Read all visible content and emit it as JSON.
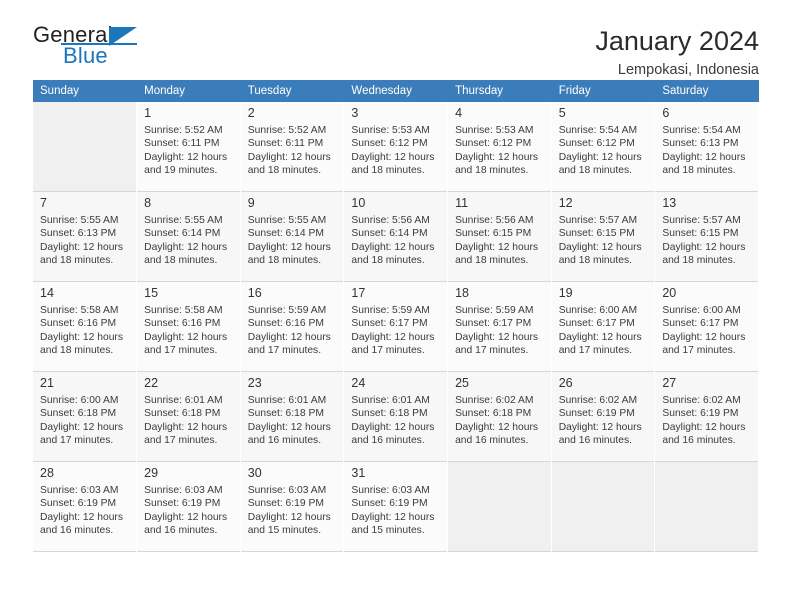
{
  "brand": {
    "name_top": "General",
    "name_bottom": "Blue",
    "accent_color": "#1b76bc",
    "triangle_icon": "triangle-icon"
  },
  "header": {
    "title": "January 2024",
    "subtitle": "Lempokasi, Indonesia"
  },
  "calendar": {
    "header_bg": "#3b7cba",
    "weekday_headers": [
      "Sunday",
      "Monday",
      "Tuesday",
      "Wednesday",
      "Thursday",
      "Friday",
      "Saturday"
    ],
    "weeks": [
      [
        {
          "day": "",
          "detail": ""
        },
        {
          "day": "1",
          "detail": "Sunrise: 5:52 AM\nSunset: 6:11 PM\nDaylight: 12 hours\nand 19 minutes."
        },
        {
          "day": "2",
          "detail": "Sunrise: 5:52 AM\nSunset: 6:11 PM\nDaylight: 12 hours\nand 18 minutes."
        },
        {
          "day": "3",
          "detail": "Sunrise: 5:53 AM\nSunset: 6:12 PM\nDaylight: 12 hours\nand 18 minutes."
        },
        {
          "day": "4",
          "detail": "Sunrise: 5:53 AM\nSunset: 6:12 PM\nDaylight: 12 hours\nand 18 minutes."
        },
        {
          "day": "5",
          "detail": "Sunrise: 5:54 AM\nSunset: 6:12 PM\nDaylight: 12 hours\nand 18 minutes."
        },
        {
          "day": "6",
          "detail": "Sunrise: 5:54 AM\nSunset: 6:13 PM\nDaylight: 12 hours\nand 18 minutes."
        }
      ],
      [
        {
          "day": "7",
          "detail": "Sunrise: 5:55 AM\nSunset: 6:13 PM\nDaylight: 12 hours\nand 18 minutes."
        },
        {
          "day": "8",
          "detail": "Sunrise: 5:55 AM\nSunset: 6:14 PM\nDaylight: 12 hours\nand 18 minutes."
        },
        {
          "day": "9",
          "detail": "Sunrise: 5:55 AM\nSunset: 6:14 PM\nDaylight: 12 hours\nand 18 minutes."
        },
        {
          "day": "10",
          "detail": "Sunrise: 5:56 AM\nSunset: 6:14 PM\nDaylight: 12 hours\nand 18 minutes."
        },
        {
          "day": "11",
          "detail": "Sunrise: 5:56 AM\nSunset: 6:15 PM\nDaylight: 12 hours\nand 18 minutes."
        },
        {
          "day": "12",
          "detail": "Sunrise: 5:57 AM\nSunset: 6:15 PM\nDaylight: 12 hours\nand 18 minutes."
        },
        {
          "day": "13",
          "detail": "Sunrise: 5:57 AM\nSunset: 6:15 PM\nDaylight: 12 hours\nand 18 minutes."
        }
      ],
      [
        {
          "day": "14",
          "detail": "Sunrise: 5:58 AM\nSunset: 6:16 PM\nDaylight: 12 hours\nand 18 minutes."
        },
        {
          "day": "15",
          "detail": "Sunrise: 5:58 AM\nSunset: 6:16 PM\nDaylight: 12 hours\nand 17 minutes."
        },
        {
          "day": "16",
          "detail": "Sunrise: 5:59 AM\nSunset: 6:16 PM\nDaylight: 12 hours\nand 17 minutes."
        },
        {
          "day": "17",
          "detail": "Sunrise: 5:59 AM\nSunset: 6:17 PM\nDaylight: 12 hours\nand 17 minutes."
        },
        {
          "day": "18",
          "detail": "Sunrise: 5:59 AM\nSunset: 6:17 PM\nDaylight: 12 hours\nand 17 minutes."
        },
        {
          "day": "19",
          "detail": "Sunrise: 6:00 AM\nSunset: 6:17 PM\nDaylight: 12 hours\nand 17 minutes."
        },
        {
          "day": "20",
          "detail": "Sunrise: 6:00 AM\nSunset: 6:17 PM\nDaylight: 12 hours\nand 17 minutes."
        }
      ],
      [
        {
          "day": "21",
          "detail": "Sunrise: 6:00 AM\nSunset: 6:18 PM\nDaylight: 12 hours\nand 17 minutes."
        },
        {
          "day": "22",
          "detail": "Sunrise: 6:01 AM\nSunset: 6:18 PM\nDaylight: 12 hours\nand 17 minutes."
        },
        {
          "day": "23",
          "detail": "Sunrise: 6:01 AM\nSunset: 6:18 PM\nDaylight: 12 hours\nand 16 minutes."
        },
        {
          "day": "24",
          "detail": "Sunrise: 6:01 AM\nSunset: 6:18 PM\nDaylight: 12 hours\nand 16 minutes."
        },
        {
          "day": "25",
          "detail": "Sunrise: 6:02 AM\nSunset: 6:18 PM\nDaylight: 12 hours\nand 16 minutes."
        },
        {
          "day": "26",
          "detail": "Sunrise: 6:02 AM\nSunset: 6:19 PM\nDaylight: 12 hours\nand 16 minutes."
        },
        {
          "day": "27",
          "detail": "Sunrise: 6:02 AM\nSunset: 6:19 PM\nDaylight: 12 hours\nand 16 minutes."
        }
      ],
      [
        {
          "day": "28",
          "detail": "Sunrise: 6:03 AM\nSunset: 6:19 PM\nDaylight: 12 hours\nand 16 minutes."
        },
        {
          "day": "29",
          "detail": "Sunrise: 6:03 AM\nSunset: 6:19 PM\nDaylight: 12 hours\nand 16 minutes."
        },
        {
          "day": "30",
          "detail": "Sunrise: 6:03 AM\nSunset: 6:19 PM\nDaylight: 12 hours\nand 15 minutes."
        },
        {
          "day": "31",
          "detail": "Sunrise: 6:03 AM\nSunset: 6:19 PM\nDaylight: 12 hours\nand 15 minutes."
        },
        {
          "day": "",
          "detail": ""
        },
        {
          "day": "",
          "detail": ""
        },
        {
          "day": "",
          "detail": ""
        }
      ]
    ]
  }
}
